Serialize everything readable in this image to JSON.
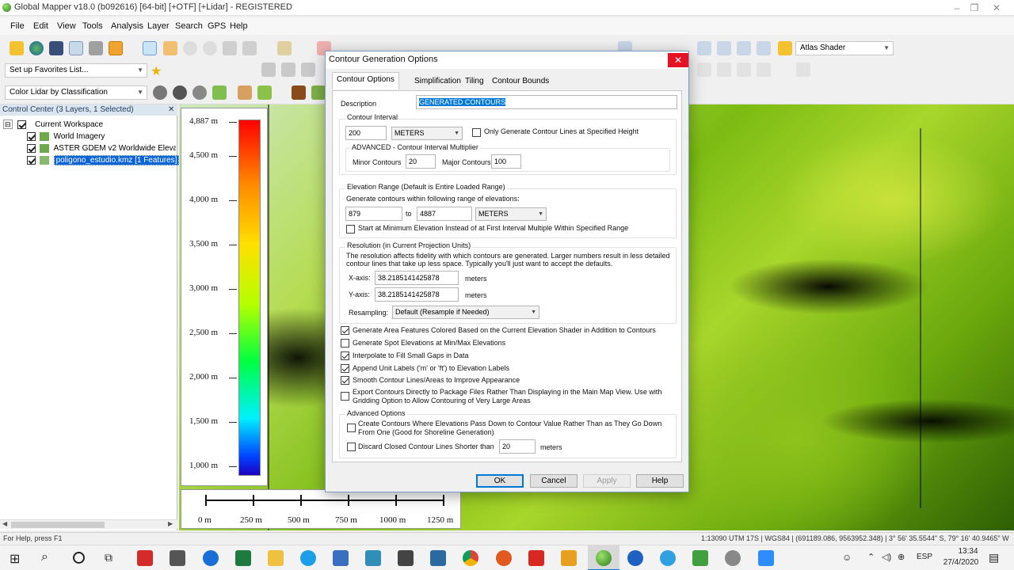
{
  "window": {
    "title": "Global Mapper v18.0 (b092616) [64-bit] [+OTF] [+Lidar] - REGISTERED"
  },
  "menu": [
    "File",
    "Edit",
    "View",
    "Tools",
    "Analysis",
    "Layer",
    "Search",
    "GPS",
    "Help"
  ],
  "toolbar": {
    "shader_select": "Atlas Shader",
    "favorites_select": "Set up Favorites List...",
    "lidar_select": "Color Lidar by Classification"
  },
  "control_center": {
    "header": "Control Center (3 Layers, 1 Selected)",
    "root": "Current Workspace",
    "layers": [
      {
        "label": "World Imagery",
        "checked": true,
        "selected": false
      },
      {
        "label": "ASTER GDEM v2 Worldwide Elevation",
        "checked": true,
        "selected": false
      },
      {
        "label": "poligono_estudio.kmz [1 Features]",
        "checked": true,
        "selected": true
      }
    ]
  },
  "map": {
    "legend_labels": [
      "4,887 m",
      "4,500 m",
      "4,000 m",
      "3,500 m",
      "3,000 m",
      "2,500 m",
      "2,000 m",
      "1,500 m",
      "1,000 m"
    ],
    "scale_labels": [
      "0 m",
      "250 m",
      "500 m",
      "750 m",
      "1000 m",
      "1250 m"
    ]
  },
  "dialog": {
    "title": "Contour Generation Options",
    "tabs": [
      "Contour Options",
      "Simplification",
      "Tiling",
      "Contour Bounds"
    ],
    "description_label": "Description",
    "description_value": "GENERATED CONTOURS",
    "contour_interval": {
      "title": "Contour Interval",
      "value": "200",
      "unit": "METERS",
      "only_specified_label": "Only Generate Contour Lines at Specified Height",
      "advanced_title": "ADVANCED - Contour Interval Multiplier",
      "minor_label": "Minor Contours",
      "minor_value": "20",
      "major_label": "Major Contours",
      "major_value": "100"
    },
    "elevation_range": {
      "title": "Elevation Range (Default is Entire Loaded Range)",
      "subtitle": "Generate contours within following range of elevations:",
      "from": "879",
      "to_label": "to",
      "to": "4887",
      "unit": "METERS",
      "start_min_label": "Start at Minimum Elevation Instead of at First Interval Multiple Within Specified Range"
    },
    "resolution": {
      "title": "Resolution (in Current Projection Units)",
      "note_line1": "The resolution affects fidelity with which contours are generated. Larger numbers result in less detailed",
      "note_line2": "contour lines that take up less space. Typically you'll just want to accept the defaults.",
      "x_label": "X-axis:",
      "x_value": "38.2185141425878",
      "y_label": "Y-axis:",
      "y_value": "38.2185141425878",
      "unit": "meters",
      "resampling_label": "Resampling:",
      "resampling_value": "Default (Resample if Needed)"
    },
    "options": [
      {
        "label": "Generate Area Features Colored Based on the Current Elevation Shader in Addition to Contours",
        "checked": true
      },
      {
        "label": "Generate Spot Elevations at Min/Max Elevations",
        "checked": false
      },
      {
        "label": "Interpolate to Fill Small Gaps in Data",
        "checked": true
      },
      {
        "label": "Append Unit Labels ('m' or 'ft') to Elevation Labels",
        "checked": true
      },
      {
        "label": "Smooth Contour Lines/Areas to Improve Appearance",
        "checked": true
      }
    ],
    "export_option": {
      "line1": "Export Contours Directly to Package Files Rather Than Displaying in the Main Map View. Use with",
      "line2": "Gridding Option to Allow Contouring of Very Large Areas",
      "checked": false
    },
    "advanced": {
      "title": "Advanced Options",
      "create_line1": "Create Contours Where Elevations Pass Down to Contour Value Rather Than as They Go Down",
      "create_line2": "From One (Good for Shoreline Generation)",
      "discard_label": "Discard Closed Contour Lines Shorter than",
      "discard_value": "20",
      "discard_unit": "meters"
    },
    "buttons": {
      "ok": "OK",
      "cancel": "Cancel",
      "apply": "Apply",
      "help": "Help"
    }
  },
  "status": {
    "left": "For Help, press F1",
    "right": "1:13090  UTM 17S | WGS84 | (691189.086, 9563952.348) | 3° 56' 35.5544\" S, 79° 16' 40.9465\" W"
  },
  "taskbar": {
    "lang": "ESP",
    "time": "13:34",
    "date": "27/4/2020"
  },
  "colors": {
    "accent": "#0078d7",
    "close_red": "#e81123",
    "selected_layer": "#0a64d8"
  }
}
